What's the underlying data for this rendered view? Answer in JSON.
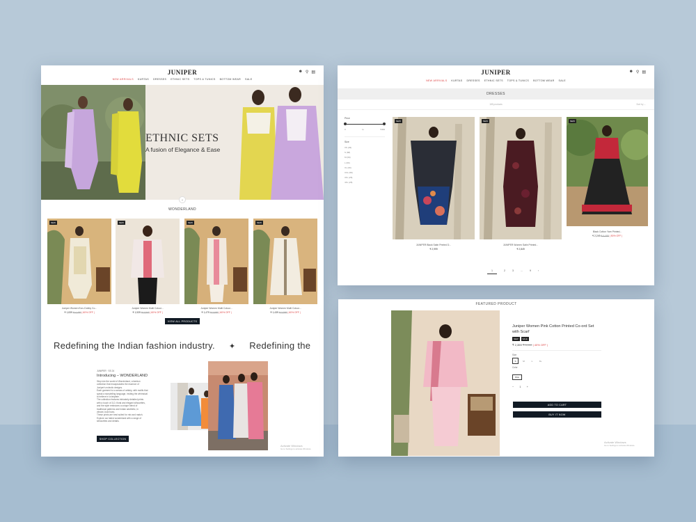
{
  "brand": {
    "logo": "JUNIPER"
  },
  "nav": [
    "NEW ARRIVALS",
    "KURTAS",
    "DRESSES",
    "ETHNIC SETS",
    "TOPS & TUNICS",
    "BOTTOM WEAR",
    "SALE"
  ],
  "home": {
    "hero": {
      "title": "ETHNIC SETS",
      "subtitle": "A fusion of Elegance & Ease"
    },
    "section_title": "WONDERLAND",
    "products": [
      {
        "badge": "NEW",
        "name": "Juniper Women Ecru Dobby Co...",
        "price": "₹ 1,839",
        "old": "₹ 4,499",
        "off": "| 60% OFF |"
      },
      {
        "badge": "NEW",
        "name": "Juniper Women Multi Colour...",
        "price": "₹ 1,539",
        "old": "₹ 3,849",
        "off": "| 60% OFF |"
      },
      {
        "badge": "NEW",
        "name": "Juniper Women Multi Colour...",
        "price": "₹ 1,479",
        "old": "₹ 3,699",
        "off": "| 60% OFF |"
      },
      {
        "badge": "NEW",
        "name": "Juniper Women Multi Colour...",
        "price": "₹ 1,439",
        "old": "₹ 3,599",
        "off": "| 60% OFF |"
      }
    ],
    "view_all": "VIEW ALL PRODUCTS",
    "marquee": [
      "Redefining the Indian fashion industry.",
      "✦",
      "Redefining the"
    ],
    "intro": {
      "eyebrow": "JUNIPER · SS 24",
      "title": "Introducing – WONDERLAND",
      "body": [
        "Step into the world of Wonderland, a fashion",
        "collection that encapsulates the essence of",
        "Juniper's eclectic designs.",
        "Each garment is a canvas of artistry, with motifs that",
        "speak a storytelling language, inviting the whimsical",
        "to believe in a fairytale.",
        "The collection features intricately detailed prints",
        "with a touch of 3-D, floral and elegant silhouettes,",
        "and the style embraces a unique blend of",
        "traditional patterns and Indian aesthetic, in",
        "vibrant, bold hues.",
        "These prints are best suited for mix and match.",
        "Explore our latest wonderland with a range of",
        "silhouettes and details."
      ],
      "button": "SHOP COLLECTION"
    },
    "watermark": [
      "Activate Windows",
      "Go to Settings to activate Windows."
    ]
  },
  "listing": {
    "title": "DRESSES",
    "count": "185 products",
    "sort": "Sort by",
    "filter_price_label": "Price",
    "price_from": "0",
    "price_to": "5499",
    "price_to_label": "to",
    "filter_size_label": "Size",
    "sizes": [
      "XS (29)",
      "S (68)",
      "M (69)",
      "L (69)",
      "XL (69)",
      "XXL (58)",
      "3XL (28)",
      "4XL (28)"
    ],
    "products": [
      {
        "badge": "NEW",
        "name": "JUNIPER Black Satin Printed D...",
        "price": "₹ 2,999"
      },
      {
        "badge": "NEW",
        "name": "JUNIPER Women Satin Printed...",
        "price": "₹ 2,849"
      },
      {
        "badge": "NEW",
        "name": "Black Cotton Yarn Printed...",
        "price": "₹ 2,249",
        "old": "₹ 4,499",
        "off": "| 50% OFF |"
      }
    ],
    "pages": [
      "1",
      "2",
      "3",
      "...",
      "9",
      "›"
    ]
  },
  "featured": {
    "heading": "FEATURED PRODUCT",
    "title": "Juniper Women Pink Cotton Printed Co-ord Set with Scarf",
    "badges": [
      "NEW",
      "SALE"
    ],
    "price": "₹ 2,359",
    "old": "₹ 3,930",
    "off": "| 40% OFF |",
    "size_label": "Size",
    "sizes": [
      "S",
      "M",
      "L",
      "XL"
    ],
    "color_label": "Color",
    "color_value": "Pink",
    "qty": "1",
    "qty_minus": "−",
    "qty_plus": "+",
    "add_to_cart": "ADD TO CART",
    "buy_now": "BUY IT NOW",
    "watermark": [
      "Activate Windows",
      "Go to Settings to activate Windows."
    ]
  },
  "icons": [
    "user-icon",
    "search-icon",
    "bag-icon",
    "chevron-down-icon"
  ],
  "colors": {
    "background": "#b7c9d8",
    "accent": "#d44444",
    "dark_button": "#111a24",
    "hero_bg": "#ece7df"
  }
}
